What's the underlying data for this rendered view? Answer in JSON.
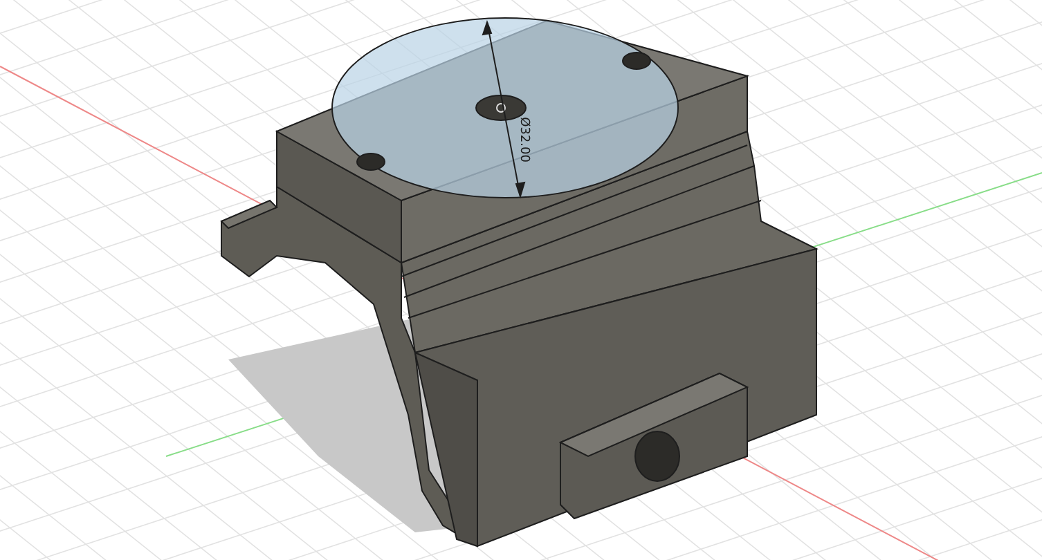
{
  "viewport": {
    "dimension": {
      "label": "Ø32.00"
    }
  }
}
